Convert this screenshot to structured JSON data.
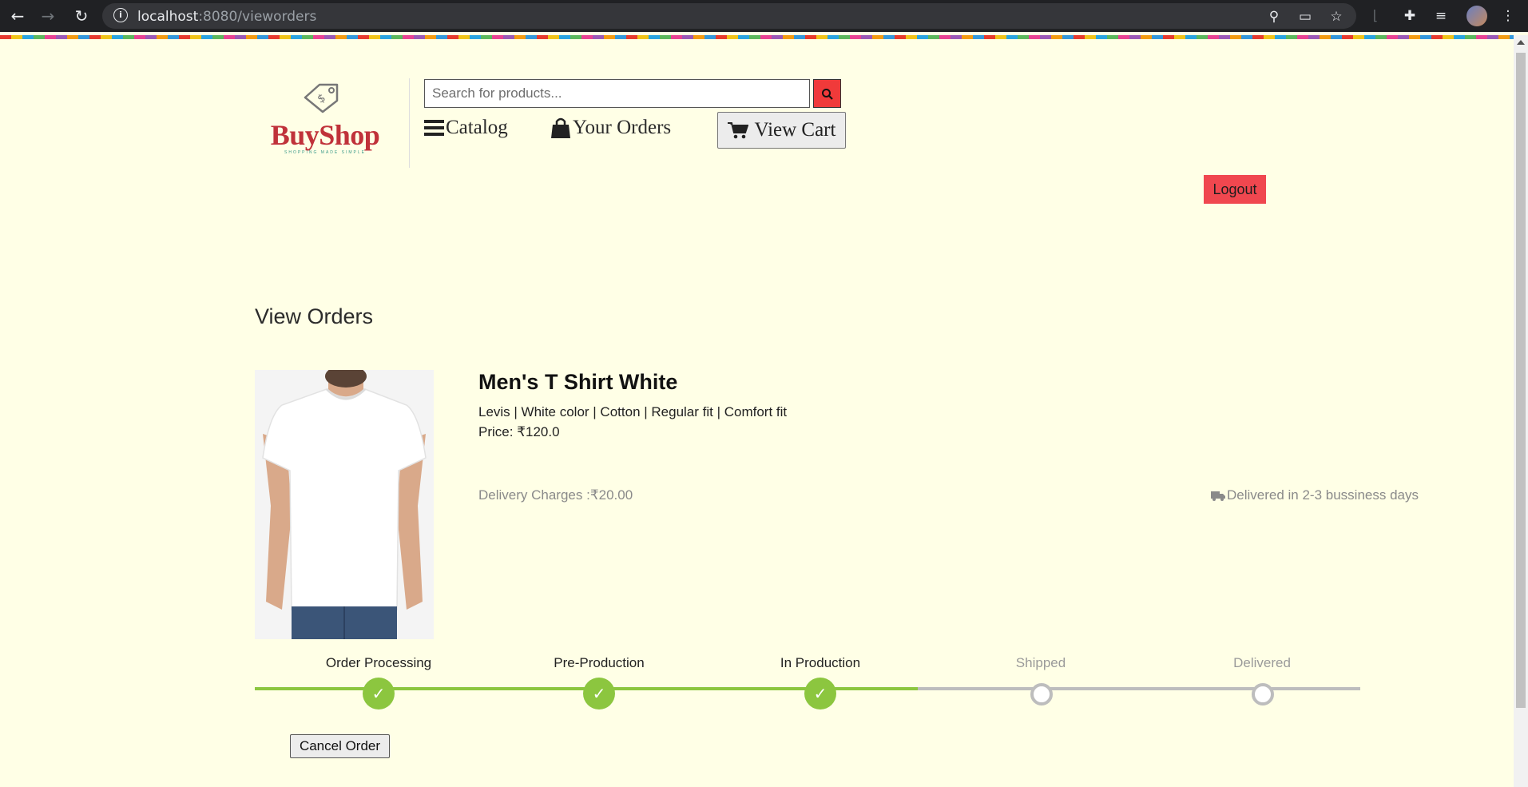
{
  "browser": {
    "url_host": "localhost",
    "url_path": ":8080/vieworders"
  },
  "header": {
    "brand": "BuyShop",
    "tagline": "SHOPPING MADE SIMPLE",
    "search_placeholder": "Search for products...",
    "nav": {
      "catalog": "Catalog",
      "orders": "Your Orders",
      "cart": "View Cart"
    },
    "logout": "Logout"
  },
  "page": {
    "title": "View Orders"
  },
  "order": {
    "product_name": "Men's T Shirt White",
    "description": "Levis | White color | Cotton | Regular fit | Comfort fit",
    "price": "Price: ₹120.0",
    "delivery_charges": "Delivery Charges :₹20.00",
    "delivery_time": "Delivered in 2-3 bussiness days",
    "progress_fraction": 0.6,
    "stages": [
      {
        "label": "Order Processing",
        "status": "done"
      },
      {
        "label": "Pre-Production",
        "status": "done"
      },
      {
        "label": "In Production",
        "status": "done"
      },
      {
        "label": "Shipped",
        "status": "pending"
      },
      {
        "label": "Delivered",
        "status": "pending"
      }
    ],
    "cancel_label": "Cancel Order"
  },
  "colors": {
    "page_bg": "#ffffe6",
    "accent_red": "#f03a3a",
    "progress_green": "#8cc63f",
    "brand_red": "#c0323a"
  }
}
